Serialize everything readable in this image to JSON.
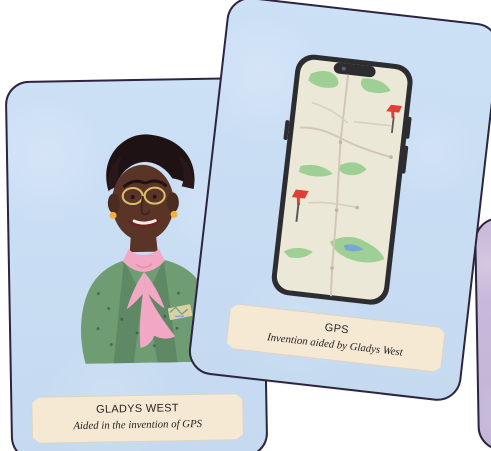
{
  "cards": {
    "west": {
      "title": "GLADYS WEST",
      "subtitle": "Aided in the invention of GPS"
    },
    "gps": {
      "title": "GPS",
      "subtitle": "Invention aided by Gladys West"
    }
  },
  "colors": {
    "card_blue": "#c9def5",
    "card_purple": "#c7b8da",
    "card_border": "#2d2440",
    "caption_bg": "#f5e9d4",
    "jacket_green": "#6f9c73",
    "scarf_pink": "#f2a7c4",
    "skin_brown": "#5a3426",
    "phone_black": "#2d2d31",
    "map_green": "#9ecf94",
    "pin_red": "#e23e35"
  },
  "icons": {
    "portrait": "portrait-illustration",
    "phone": "phone-map-illustration",
    "pin": "map-pin-icon"
  }
}
